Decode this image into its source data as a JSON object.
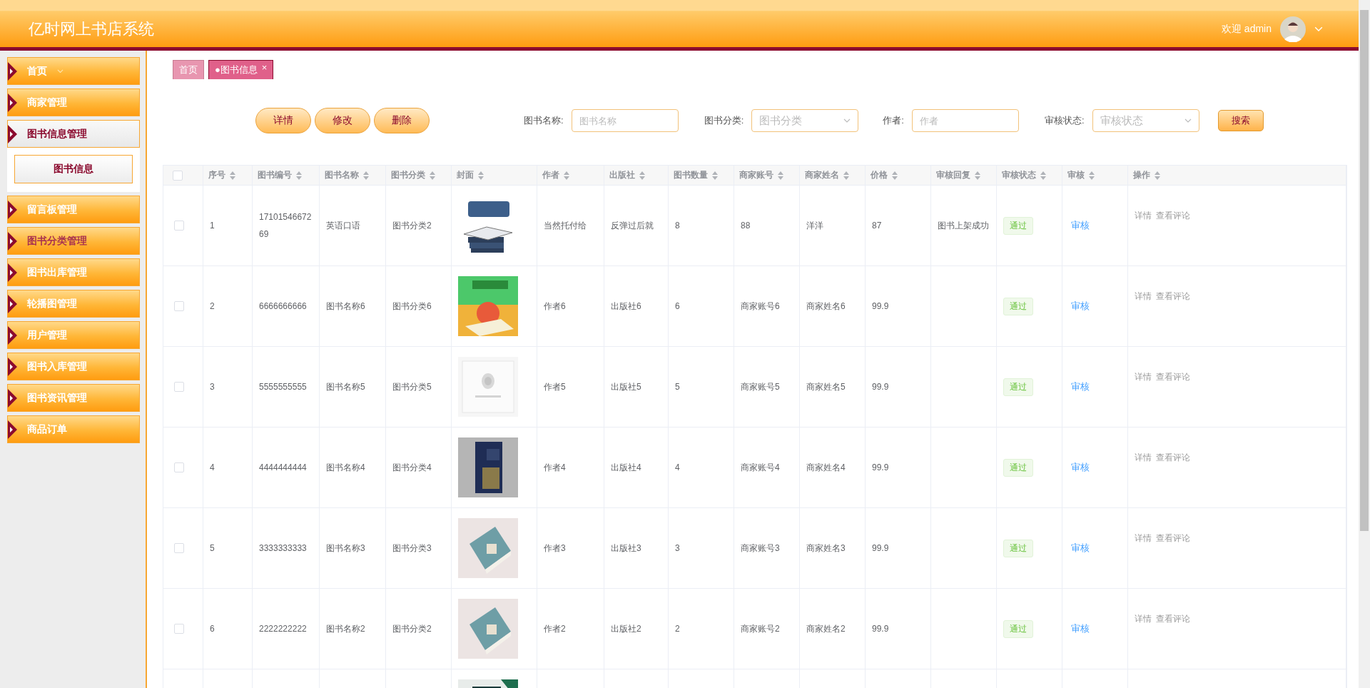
{
  "header": {
    "title": "亿时网上书店系统",
    "welcome": "欢迎 admin"
  },
  "sidebar": {
    "items": [
      {
        "label": "首页",
        "kind": "menu",
        "expanded": false,
        "hovered": false
      },
      {
        "label": "商家管理",
        "kind": "group",
        "expanded": false,
        "hovered": false
      },
      {
        "label": "图书信息管理",
        "kind": "group",
        "expanded": true,
        "hovered": false,
        "children": [
          {
            "label": "图书信息",
            "selected": true
          }
        ]
      },
      {
        "label": "留言板管理",
        "kind": "group",
        "expanded": false,
        "hovered": false
      },
      {
        "label": "图书分类管理",
        "kind": "group",
        "expanded": false,
        "hovered": true
      },
      {
        "label": "图书出库管理",
        "kind": "group",
        "expanded": false,
        "hovered": false
      },
      {
        "label": "轮播图管理",
        "kind": "group",
        "expanded": false,
        "hovered": false
      },
      {
        "label": "用户管理",
        "kind": "group",
        "expanded": false,
        "hovered": false
      },
      {
        "label": "图书入库管理",
        "kind": "group",
        "expanded": false,
        "hovered": false
      },
      {
        "label": "图书资讯管理",
        "kind": "group",
        "expanded": false,
        "hovered": false
      },
      {
        "label": "商品订单",
        "kind": "group",
        "expanded": false,
        "hovered": false
      }
    ]
  },
  "tabs": [
    {
      "label": "首页",
      "selected": false
    },
    {
      "label": "●图书信息",
      "selected": true,
      "close": "×"
    }
  ],
  "toolbar": {
    "buttons": [
      "详情",
      "修改",
      "删除"
    ],
    "filters": [
      {
        "label": "图书名称:",
        "kind": "input",
        "placeholder": "图书名称"
      },
      {
        "label": "图书分类:",
        "kind": "select",
        "placeholder": "图书分类"
      },
      {
        "label": "作者:",
        "kind": "input",
        "placeholder": "作者"
      },
      {
        "label": "审核状态:",
        "kind": "select",
        "placeholder": "审核状态"
      }
    ],
    "search": "搜索"
  },
  "table": {
    "select_all": {
      "checked": false
    },
    "columns": [
      "序号",
      "图书编号",
      "图书名称",
      "图书分类",
      "封面",
      "作者",
      "出版社",
      "图书数量",
      "商家账号",
      "商家姓名",
      "价格",
      "审核回复",
      "审核状态",
      "审核",
      "操作"
    ],
    "rows": [
      {
        "checked": false,
        "cells": [
          "1",
          "1710154667269",
          "英语口语",
          "图书分类2",
          null,
          "当然托付给",
          "反弹过后就",
          "8",
          "88",
          "洋洋",
          "87",
          "图书上架成功"
        ],
        "status": "通过",
        "review": "审核",
        "actions": [
          "详情",
          "查看评论"
        ]
      },
      {
        "checked": false,
        "cells": [
          "2",
          "6666666666",
          "图书名称6",
          "图书分类6",
          null,
          "作者6",
          "出版社6",
          "6",
          "商家账号6",
          "商家姓名6",
          "99.9"
        ],
        "status": "通过",
        "review": "审核",
        "actions": [
          "详情",
          "查看评论"
        ]
      },
      {
        "checked": false,
        "cells": [
          "3",
          "5555555555",
          "图书名称5",
          "图书分类5",
          null,
          "作者5",
          "出版社5",
          "5",
          "商家账号5",
          "商家姓名5",
          "99.9"
        ],
        "status": "通过",
        "review": "审核",
        "actions": [
          "详情",
          "查看评论"
        ]
      },
      {
        "checked": false,
        "cells": [
          "4",
          "4444444444",
          "图书名称4",
          "图书分类4",
          null,
          "作者4",
          "出版社4",
          "4",
          "商家账号4",
          "商家姓名4",
          "99.9"
        ],
        "status": "通过",
        "review": "审核",
        "actions": [
          "详情",
          "查看评论"
        ]
      },
      {
        "checked": false,
        "cells": [
          "5",
          "3333333333",
          "图书名称3",
          "图书分类3",
          null,
          "作者3",
          "出版社3",
          "3",
          "商家账号3",
          "商家姓名3",
          "99.9"
        ],
        "status": "通过",
        "review": "审核",
        "actions": [
          "详情",
          "查看评论"
        ]
      },
      {
        "checked": false,
        "cells": [
          "6",
          "2222222222",
          "图书名称2",
          "图书分类2",
          null,
          "作者2",
          "出版社2",
          "2",
          "商家账号2",
          "商家姓名2",
          "99.9"
        ],
        "status": "通过",
        "review": "审核",
        "actions": [
          "详情",
          "查看评论"
        ]
      }
    ]
  }
}
